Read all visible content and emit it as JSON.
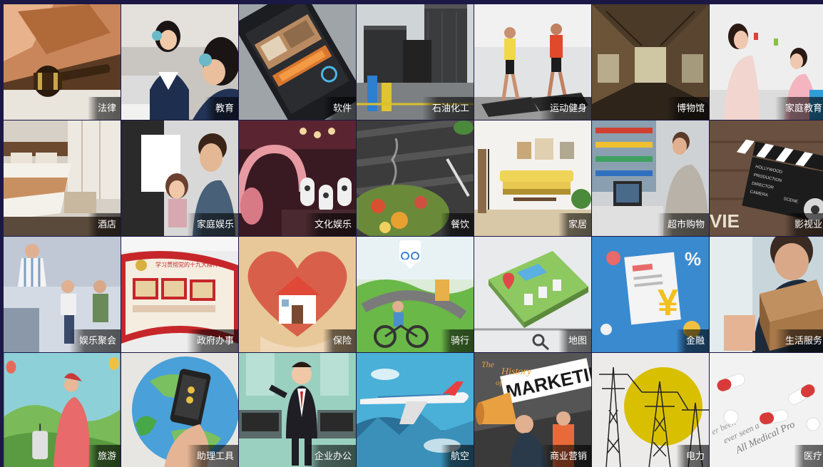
{
  "tiles": [
    {
      "label": "法律",
      "icon": "gavel-icon"
    },
    {
      "label": "教育",
      "icon": "student-headphones-icon"
    },
    {
      "label": "软件",
      "icon": "smartphone-app-icon"
    },
    {
      "label": "石油化工",
      "icon": "storage-tanks-icon"
    },
    {
      "label": "运动健身",
      "icon": "treadmill-icon"
    },
    {
      "label": "博物馆",
      "icon": "museum-hall-icon"
    },
    {
      "label": "家庭教育",
      "icon": "mother-child-icon"
    },
    {
      "label": "酒店",
      "icon": "hotel-bed-icon"
    },
    {
      "label": "家庭娱乐",
      "icon": "children-icon"
    },
    {
      "label": "文化娱乐",
      "icon": "headphones-stage-icon"
    },
    {
      "label": "餐饮",
      "icon": "food-plate-icon"
    },
    {
      "label": "家居",
      "icon": "living-room-icon"
    },
    {
      "label": "超市购物",
      "icon": "checkout-counter-icon"
    },
    {
      "label": "影视业",
      "icon": "clapperboard-icon"
    },
    {
      "label": "娱乐聚会",
      "icon": "party-people-icon"
    },
    {
      "label": "政府办事",
      "icon": "notice-board-icon"
    },
    {
      "label": "保险",
      "icon": "heart-house-icon"
    },
    {
      "label": "骑行",
      "icon": "cyclist-icon"
    },
    {
      "label": "地图",
      "icon": "map-city-icon"
    },
    {
      "label": "金融",
      "icon": "yuan-document-icon"
    },
    {
      "label": "生活服务",
      "icon": "delivery-box-icon"
    },
    {
      "label": "旅游",
      "icon": "traveler-icon"
    },
    {
      "label": "助理工具",
      "icon": "phone-assistant-icon"
    },
    {
      "label": "企业办公",
      "icon": "businessman-office-icon"
    },
    {
      "label": "航空",
      "icon": "airplane-icon"
    },
    {
      "label": "商业营销",
      "icon": "marketing-megaphone-icon"
    },
    {
      "label": "电力",
      "icon": "power-tower-icon"
    },
    {
      "label": "医疗",
      "icon": "pills-icon"
    }
  ],
  "signage": {
    "gov_board": "学习贯彻党的十九大精神",
    "marketing_title": "MARKETING",
    "marketing_sub1": "The",
    "marketing_sub2": "History",
    "marketing_sub3": "of",
    "film_text": "VIE",
    "clapper_rows": [
      "HOLLYWOOD",
      "PRODUCTION",
      "DIRECTOR",
      "CAMERA",
      "SCENE"
    ],
    "medical_text": "All Medical Pro",
    "medical_text2": "ever seen a",
    "medical_text3": "er been",
    "finance_symbol": "¥",
    "finance_percent": "%"
  },
  "colors": {
    "page_bg": "#1b1846",
    "label_text": "#ffffff"
  }
}
